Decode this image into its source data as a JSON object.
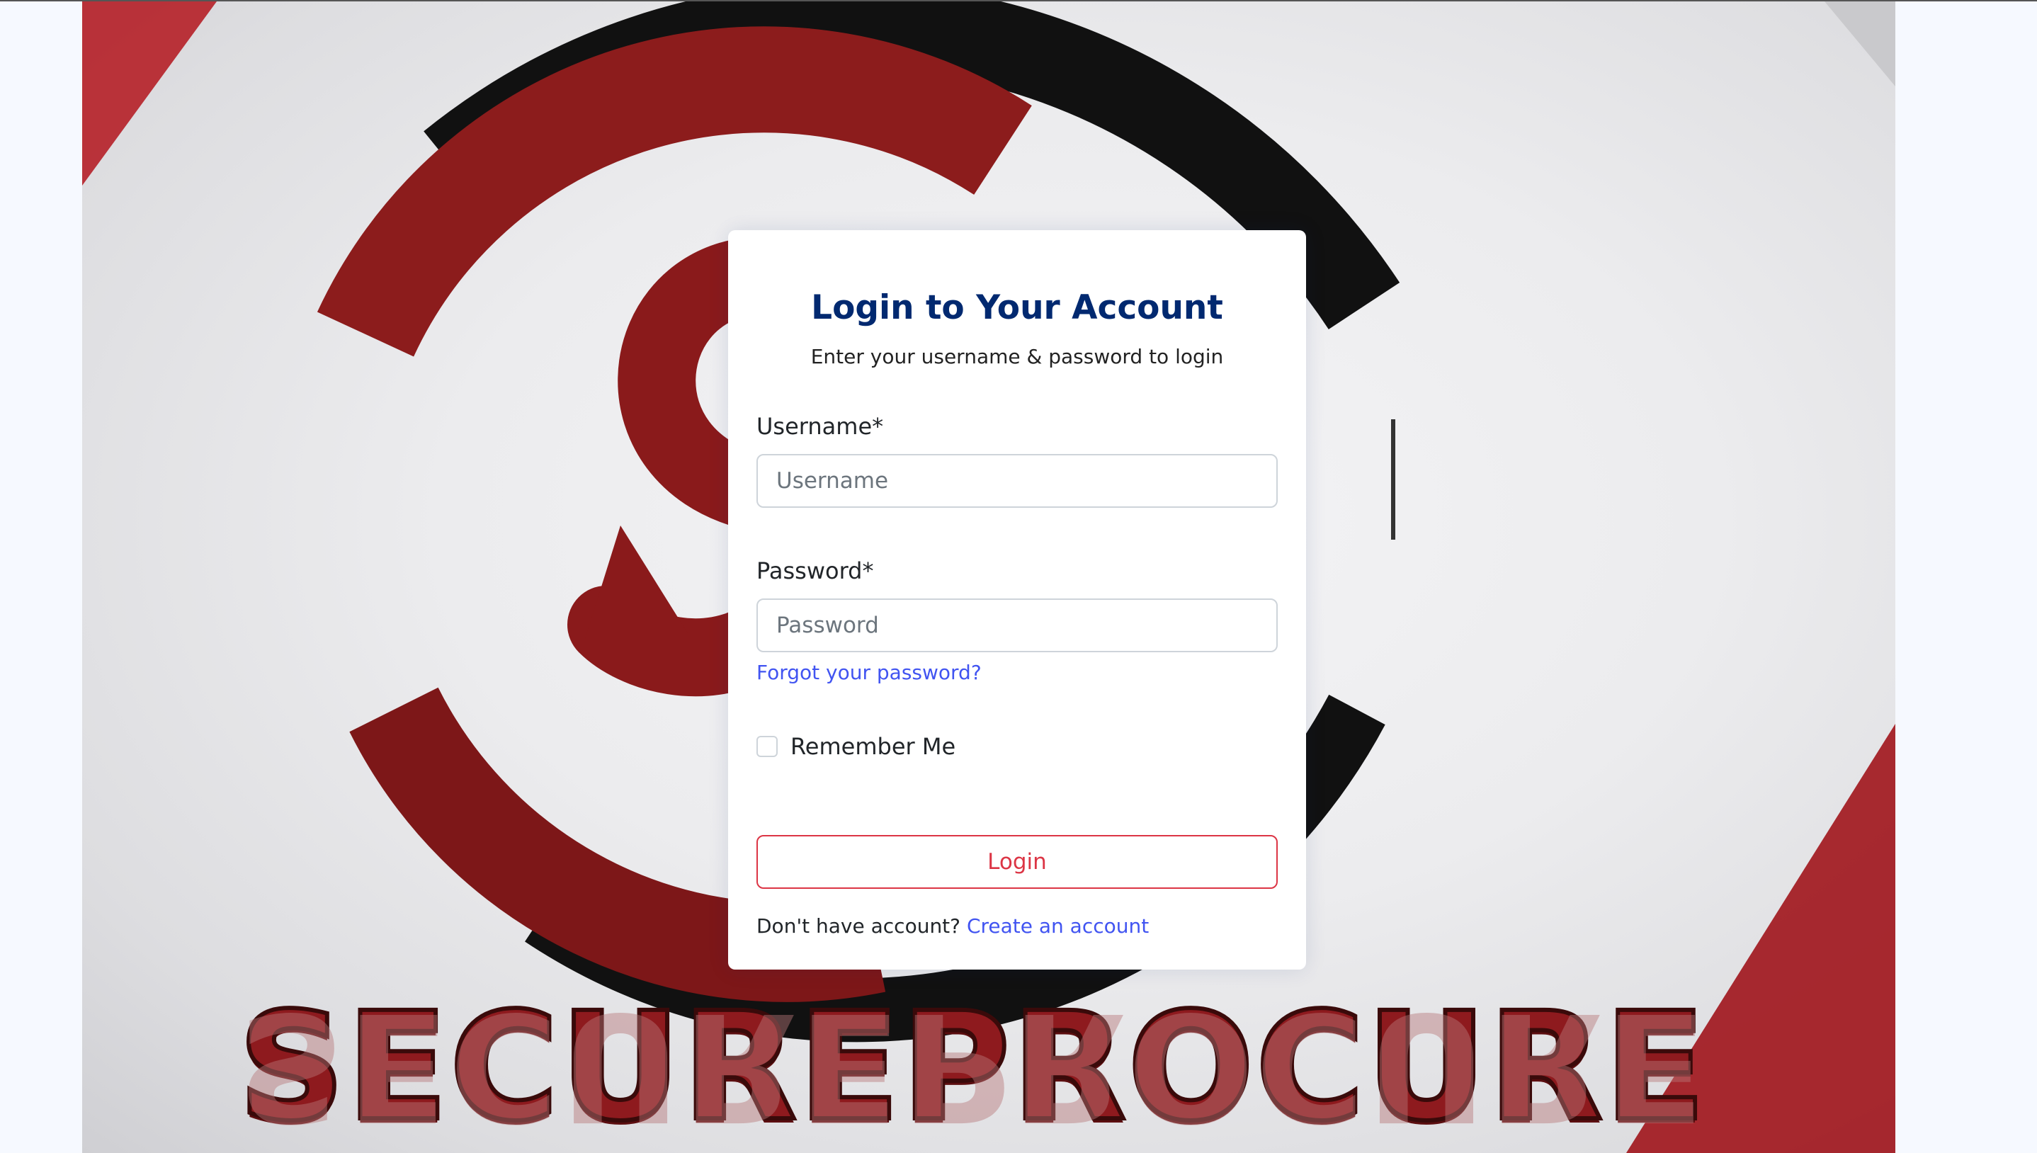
{
  "brand": {
    "wordmark": "SECUREPROCURE"
  },
  "login": {
    "title": "Login to Your Account",
    "subtitle": "Enter your username & password to login",
    "username_label": "Username*",
    "username_placeholder": "Username",
    "password_label": "Password*",
    "password_placeholder": "Password",
    "forgot_link": "Forgot your password?",
    "remember_label": "Remember Me",
    "remember_checked": false,
    "login_button": "Login",
    "signup_prompt": "Don't have account?",
    "signup_link": "Create an account"
  },
  "colors": {
    "title": "#012970",
    "link": "#4154f1",
    "button_accent": "#dc3545",
    "brand_red": "#8e1a1e"
  }
}
